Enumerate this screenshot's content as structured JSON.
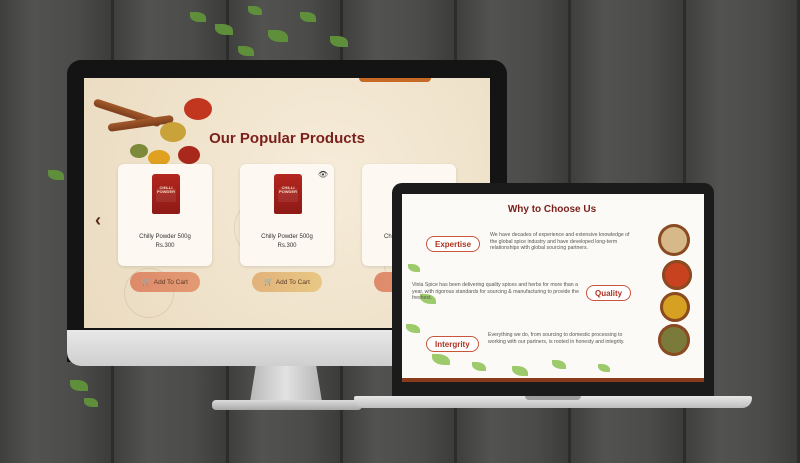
{
  "colors": {
    "brand_maroon": "#7a1f1b",
    "accent_orange": "#c66a25",
    "pill_border": "#c8553d",
    "card_bg": "#fdf9f2",
    "button_gradient_start": "#e0916a",
    "button_gradient_end": "#e6c27a",
    "pouch_red": "#b3261e"
  },
  "desktop": {
    "section_title": "Our Popular Products",
    "prev_arrow": "‹",
    "products": [
      {
        "name": "Chilly Powder 500g",
        "price": "Rs.300",
        "pouch_label": "CHILLI POWDER",
        "button": "Add To Cart",
        "show_eye": false
      },
      {
        "name": "Chilly Powder 500g",
        "price": "Rs.300",
        "pouch_label": "CHILLI POWDER",
        "button": "Add To Cart",
        "show_eye": true
      },
      {
        "name": "Ch",
        "price": "",
        "pouch_label": "",
        "button": "",
        "show_eye": false
      }
    ],
    "cart_icon": "shopping-cart-icon",
    "eye_icon": "eye-icon"
  },
  "laptop": {
    "section_title": "Why to Choose Us",
    "reasons": [
      {
        "label": "Expertise",
        "text": "We have decades of experience and extensive knowledge of the global spice industry and have developed long-term relationships with global sourcing partners."
      },
      {
        "label": "Quality",
        "text": "Vinla Spice has been delivering quality spices and herbs for more than a year, with rigorous standards for sourcing & manufacturing to provide the freshest."
      },
      {
        "label": "Intergrity",
        "text": "Everything we do, from sourcing to domestic processing to working with our partners, is rooted in honesty and integrity."
      }
    ]
  }
}
